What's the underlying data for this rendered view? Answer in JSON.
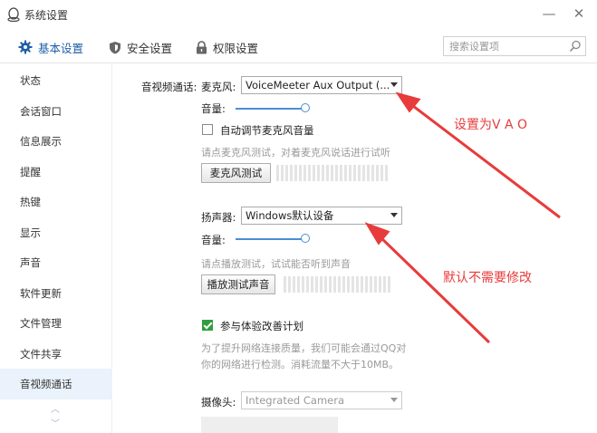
{
  "window": {
    "title": "系统设置",
    "minimize_glyph": "—",
    "close_glyph": "✕"
  },
  "tabs": [
    {
      "label": "基本设置",
      "icon": "gear-icon",
      "active": true
    },
    {
      "label": "安全设置",
      "icon": "shield-icon"
    },
    {
      "label": "权限设置",
      "icon": "lock-icon"
    }
  ],
  "search": {
    "placeholder": "搜索设置项"
  },
  "sidebar": {
    "items": [
      {
        "label": "状态"
      },
      {
        "label": "会话窗口"
      },
      {
        "label": "信息展示"
      },
      {
        "label": "提醒"
      },
      {
        "label": "热键"
      },
      {
        "label": "显示"
      },
      {
        "label": "声音"
      },
      {
        "label": "软件更新"
      },
      {
        "label": "文件管理"
      },
      {
        "label": "文件共享"
      },
      {
        "label": "音视频通话",
        "active": true
      }
    ],
    "scroll_up": "︿",
    "scroll_down": "﹀"
  },
  "av": {
    "section_label": "音视频通话:",
    "mic": {
      "label": "麦克风:",
      "device": "VoiceMeeter Aux Output (...",
      "volume_label": "音量:",
      "volume_level": 0.85,
      "auto_adjust_label": "自动调节麦克风音量",
      "auto_adjust_checked": false,
      "test_hint": "请点麦克风测试，对着麦克风说话进行试听",
      "test_button": "麦克风测试"
    },
    "speaker": {
      "label": "扬声器:",
      "device": "Windows默认设备",
      "volume_label": "音量:",
      "volume_level": 0.85,
      "test_hint": "请点播放测试，试试能否听到声音",
      "test_button": "播放测试声音"
    },
    "improve": {
      "label": "参与体验改善计划",
      "checked": true,
      "desc_line1": "为了提升网络连接质量，我们可能会通过QQ对",
      "desc_line2": "你的网络进行检测。消耗流量不大于10MB。"
    },
    "camera": {
      "label": "摄像头:",
      "device": "Integrated Camera"
    }
  },
  "annotations": {
    "note1": "设置为V A O",
    "note2": "默认不需要修改",
    "color": "#e83b3b"
  },
  "colors": {
    "accent": "#1e5fa8",
    "slider": "#4a8ed6",
    "check": "#2e9e3e"
  }
}
